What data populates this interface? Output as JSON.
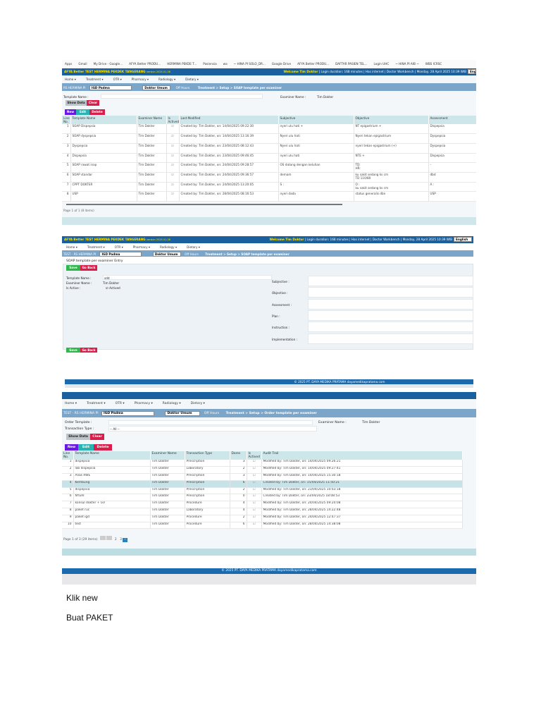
{
  "shot1": {
    "bookmarks": [
      "Apps",
      "Gmail",
      "My Drive - Google...",
      "AFYA Better PRODU...",
      "HERMINA PEKDE T...",
      "Pasiensia",
      "wa",
      "~ HINA PI SOLO_DR...",
      "Google Drive",
      "AFYA Better PRODU...",
      "DAFTAR PASIEN TEL...",
      "Login UHC",
      "~ HINA PI AIB ~",
      "WBS ICRSC"
    ],
    "brand": "AFYA Better TEST HERMINA PEKDEK TANGERANG",
    "version": "version 2025.01.28",
    "welcome": "Welcome Tim Doktor",
    "status": "| Login duration: 168 minutes | Has internet | Doctor Workbench | Monday, 28 April 2025 10:39 WIB",
    "language": "English",
    "menu": [
      "Home ▾",
      "Treatment ▾",
      "OTR ▾",
      "Pharmacy ▾",
      "Radiology ▾",
      "Dietary ▾"
    ],
    "toolbar": {
      "unit": "RS HERMINA PI",
      "location": "IGD Padma",
      "doctor": "Doktor Umum",
      "off_hours": "Off Hours",
      "breadcrumb": "Treatment  >  Setup  >  SOAP template per examiner"
    },
    "template_name_label": "Template Name :",
    "examiner_name_label": "Examiner Name :",
    "examiner_name": "Tim Dokter",
    "show_data": "Show Data",
    "clear": "Clear",
    "new": "New",
    "edit": "Edit",
    "delete": "Delete",
    "columns": [
      "Line No.",
      "Template Name",
      "Examiner Name",
      "Is Actived",
      "Last Modified",
      "Subjective",
      "Objective",
      "Assessment"
    ],
    "rows": [
      [
        "1",
        "SOAP Dispepsia",
        "Tim Dokter",
        "☑",
        "Created by: Tim Dokter, on: 14/04/2025 09:22:30",
        "nyeri ulu hati +",
        "NT epigastrium +",
        "Dispepsia"
      ],
      [
        "2",
        "SOAP dyspepsia",
        "Tim Dokter",
        "☑",
        "Created by: Tim Dokter, on: 14/04/2025 13:16:39",
        "Nyeri ulu hati",
        "Nyeri tekan epigastrium",
        "Dyspepsia"
      ],
      [
        "3",
        "Dyspepsia",
        "Tim Dokter",
        "☑",
        "Created by: Tim Dokter, on: 23/04/2025 08:12:43",
        "Nyeri ulu hati",
        "nyeri tekan epigastrium (+)",
        "Dyspepsia"
      ],
      [
        "4",
        "Dispepsia",
        "Tim Dokter",
        "☑",
        "Created by: Tim Dokter, on: 23/04/2025 09:46:45",
        "nyeri ulu hati",
        "NTE +",
        "Dispepsia"
      ],
      [
        "5",
        "SOAP rawat inap",
        "Tim Dokter",
        "☑",
        "Created by: Tim Dokter, on: 24/04/2025 09:28:57",
        "OS datang dengan keluhan",
        "TD:\nHR:",
        "-"
      ],
      [
        "6",
        "SOAP standar",
        "Tim Dokter",
        "☑",
        "Created by: Tim Dokter, on: 24/04/2025 09:36:57",
        "demam",
        "ku sakit sedang ks cm\nTD 110/80",
        "dbd"
      ],
      [
        "7",
        "CPPT DOKTER",
        "Tim Dokter",
        "☑",
        "Created by: Tim Dokter, on: 24/04/2025 13:20:05",
        "S :",
        "O :\nku sakit sedang ks cm",
        "A :"
      ],
      [
        "8",
        "USP",
        "Tim Dokter",
        "☑",
        "Created by: Tim Dokter, on: 28/04/2025 08:16:53",
        "nyeri dada",
        "status generalis dbn",
        "USP"
      ]
    ],
    "pager": "Page 1 of 1 (8 items)"
  },
  "shot2": {
    "brand": "AFYA Better TEST HERMINA PEKDEK TANGERANG",
    "version": "version 2025.01.28",
    "welcome": "Welcome Tim Doktor",
    "status": "| Login duration: 168 minutes | Has internet | Doctor Workbench | Monday, 28 April 2025 10:39 WIB",
    "language": "English",
    "menu": [
      "Home ▾",
      "Treatment ▾",
      "OTR ▾",
      "Pharmacy ▾",
      "Radiology ▾",
      "Dietary ▾"
    ],
    "toolbar": {
      "unit": "TEST - RS HERMINA PI",
      "location": "IGD Padma",
      "doctor": "Doktor Umum",
      "off_hours": "Off Hours",
      "breadcrumb": "Treatment  >  Setup  >  SOAP template per examiner"
    },
    "title": "SOAP template per examiner Entry",
    "save": "Save",
    "go_back": "Go Back",
    "fields": {
      "template_name_label": "Template Name :",
      "template_name": "sdd",
      "examiner_name_label": "Examiner Name :",
      "examiner_name": "Tim Dokter",
      "is_active_label": "Is Active :",
      "is_active": "Actived"
    },
    "soap_labels": [
      "Subjective :",
      "Objective :",
      "Assessment :",
      "Plan :",
      "Instruction :",
      "Implementation :"
    ],
    "footer": "© 2025 PT. DAYA MEDIKA PRATAMA dayamedikapratama.com"
  },
  "shot3": {
    "menu": [
      "Home ▾",
      "Treatment ▾",
      "OTR ▾",
      "Pharmacy ▾",
      "Radiology ▾",
      "Dietary ▾"
    ],
    "toolbar": {
      "unit": "TEST - RS HERMINA PI",
      "location": "IGD Padma",
      "doctor": "Doktor Umum",
      "off_hours": "Off Hours",
      "breadcrumb": "Treatment  >  Setup  >  Order template per examiner"
    },
    "order_template_label": "Order Template :",
    "transaction_type_label": "Transaction Type :",
    "transaction_type": "-- All --",
    "examiner_name_label": "Examiner Name :",
    "examiner_name": "Tim Dokter",
    "show_data": "Show Data",
    "clear": "Clear",
    "new": "New",
    "edit": "Edit",
    "delete": "Delete",
    "columns": [
      "Line No.",
      "Template Name",
      "Examiner Name",
      "Transaction Type",
      "Dares",
      "Is Actived",
      "Audit Trail"
    ],
    "rows": [
      [
        "1",
        "dispepsia",
        "Tim Dokter",
        "Prescription",
        "3",
        "☑",
        "Modified by: Tim Dokter, on: 14/04/2025 09:26:21"
      ],
      [
        "2",
        "lab dispepsia",
        "Tim Dokter",
        "Laboratory",
        "2",
        "☑",
        "Modified by: Tim Dokter, on: 14/04/2025 09:27:41"
      ],
      [
        "3",
        "Alias RWE",
        "Tim Dokter",
        "Prescription",
        "3",
        "☑",
        "Modified by: Tim Dokter, on: 14/04/2025 15:30:18"
      ],
      [
        "4",
        "Kembung",
        "Tim Dokter",
        "Prescription",
        "6",
        "☑",
        "Created by: Tim Dokter, on: 15/04/2025 11:50:21"
      ],
      [
        "5",
        "dispepsia",
        "Tim Dokter",
        "Prescription",
        "2",
        "☑",
        "Modified by: Tim Dokter, on: 23/04/2025 10:03:18"
      ],
      [
        "6",
        "NYERI",
        "Tim Dokter",
        "Prescription",
        "0",
        "☑",
        "Created by: Tim Dokter, on: 23/04/2025 18:08:53"
      ],
      [
        "7",
        "konsul dokter + GV",
        "Tim Dokter",
        "Procedure",
        "4",
        "☑",
        "Modified by: Tim Dokter, on: 24/04/2025 09:24:08"
      ],
      [
        "8",
        "paket ruc",
        "Tim Dokter",
        "Laboratory",
        "4",
        "☑",
        "Modified by: Tim Dokter, on: 28/04/2025 14:22:48"
      ],
      [
        "9",
        "paket igd",
        "Tim Dokter",
        "Procedure",
        "2",
        "☑",
        "Modified by: Tim Dokter, on: 24/04/2025 12:47:37"
      ],
      [
        "10",
        "test",
        "Tim Dokter",
        "Procedure",
        "6",
        "☑",
        "Modified by: Tim Dokter, on: 28/04/2025 14:38:08"
      ]
    ],
    "pager": "Page 1 of 3 (29 items)",
    "pages": [
      "2",
      "3"
    ],
    "footer": "© 2025 PT. DAYA MEDIKA PRATAMA dayamedikapratama.com"
  },
  "doc": {
    "line1": "Klik new",
    "line2": "Buat PAKET"
  }
}
